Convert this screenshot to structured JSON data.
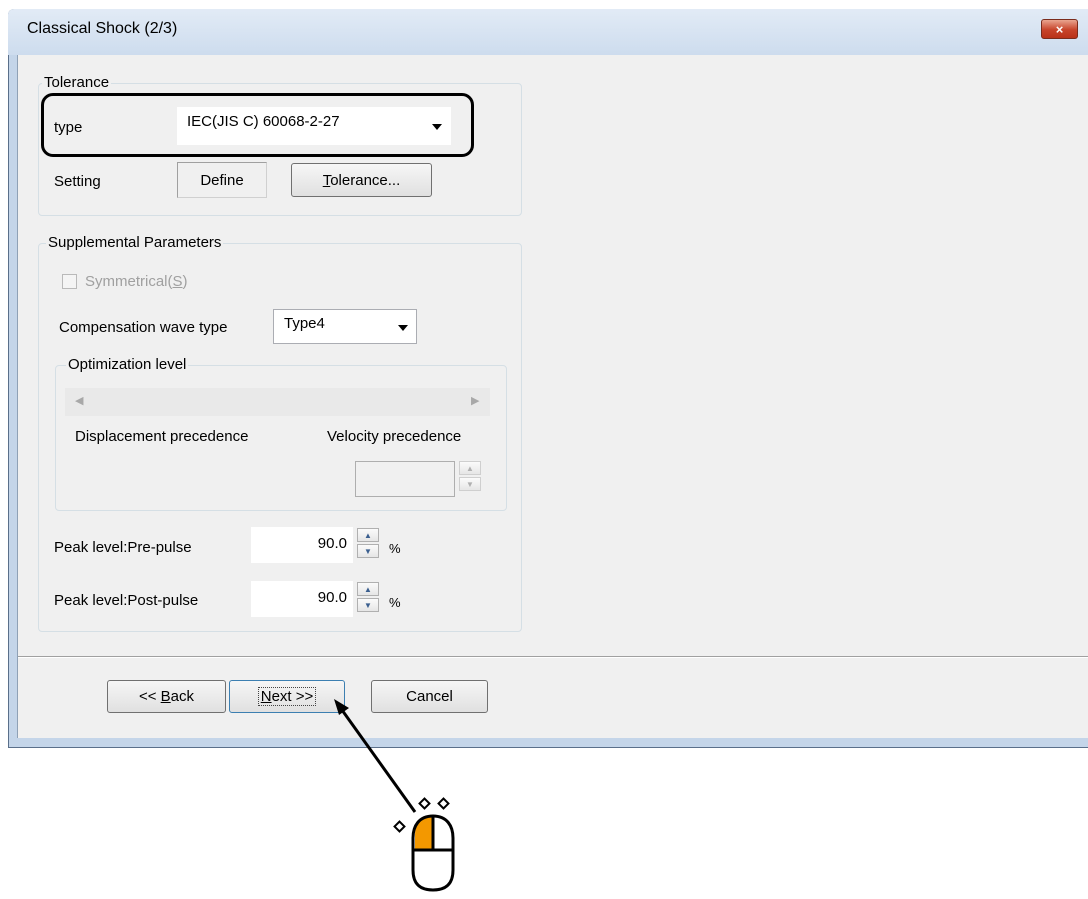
{
  "window": {
    "title": "Classical Shock (2/3)",
    "close_glyph": "×"
  },
  "tolerance": {
    "legend": "Tolerance",
    "type_label": "type",
    "type_value": "IEC(JIS C) 60068-2-27",
    "setting_label": "Setting",
    "setting_value": "Define",
    "tolerance_button": {
      "mnemonic": "T",
      "rest": "olerance..."
    }
  },
  "supplemental": {
    "legend": "Supplemental Parameters",
    "symmetrical": {
      "label_prefix": "Symmetrical(",
      "mnemonic": "S",
      "label_suffix": ")",
      "checked": false,
      "enabled": false
    },
    "comp_wave_label": "Compensation wave type",
    "comp_wave_value": "Type4",
    "optimization": {
      "legend": "Optimization level",
      "left_label": "Displacement precedence",
      "right_label": "Velocity precedence",
      "value": ""
    },
    "pre_pulse": {
      "label": "Peak level:Pre-pulse",
      "value": "90.0",
      "unit": "%"
    },
    "post_pulse": {
      "label": "Peak level:Post-pulse",
      "value": "90.0",
      "unit": "%"
    }
  },
  "buttons": {
    "back": {
      "prefix": "<< ",
      "mnemonic": "B",
      "rest": "ack"
    },
    "next": {
      "mnemonic": "N",
      "rest": "ext >>"
    },
    "cancel": "Cancel"
  },
  "colors": {
    "highlight": "#000000",
    "mouse_left_button": "#f39800"
  },
  "icons": [
    "close-icon",
    "chevron-down-icon",
    "scroll-left-icon",
    "scroll-right-icon",
    "spin-up-icon",
    "spin-down-icon",
    "mouse-click-icon",
    "pointer-arrow-icon"
  ]
}
